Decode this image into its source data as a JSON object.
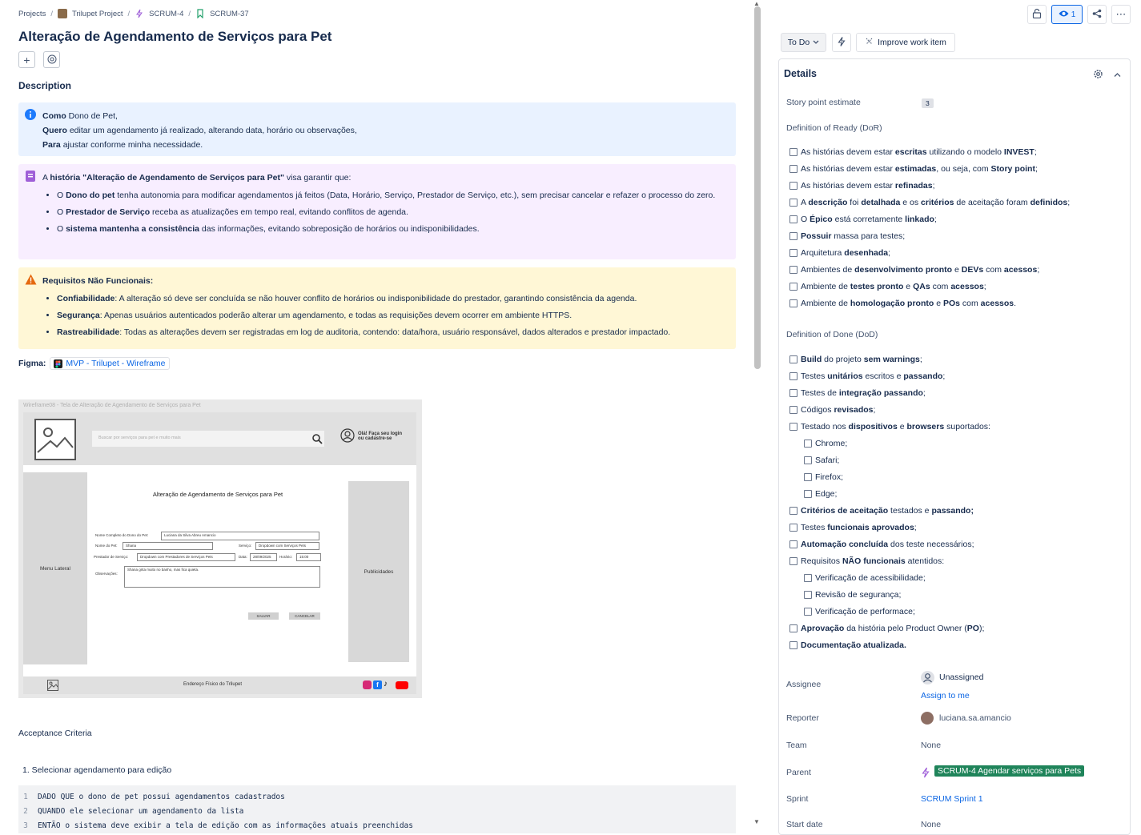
{
  "breadcrumb": {
    "projects": "Projects",
    "project": "Trilupet Project",
    "epic": "SCRUM-4",
    "issue": "SCRUM-37"
  },
  "issue": {
    "title": "Alteração de Agendamento de Serviços para Pet"
  },
  "description": {
    "heading": "Description",
    "info": {
      "l1_b": "Como",
      "l1": " Dono de Pet,",
      "l2_b": "Quero",
      "l2": " editar um agendamento já realizado, alterando data, horário ou observações,",
      "l3_b": "Para",
      "l3": " ajustar conforme minha necessidade."
    },
    "note": {
      "intro_a": "A ",
      "intro_b": "história \"Alteração de Agendamento de Serviços para Pet\"",
      "intro_c": " visa garantir que:",
      "b1_a": "O ",
      "b1_b": "Dono do pet",
      "b1_c": " tenha autonomia para modificar agendamentos já feitos (Data, Horário, Serviço, Prestador de Serviço, etc.), sem precisar cancelar e refazer o processo do zero.",
      "b2_a": "O ",
      "b2_b": "Prestador de Serviço",
      "b2_c": " receba as atualizações em tempo real, evitando conflitos de agenda.",
      "b3_a": "O ",
      "b3_b": "sistema mantenha a consistência",
      "b3_c": " das informações, evitando sobreposição de horários ou indisponibilidades."
    },
    "warn": {
      "title": "Requisitos Não Funcionais:",
      "b1_b": "Confiabilidade",
      "b1_c": ": A alteração só deve ser concluída se não houver conflito de horários ou indisponibilidade do prestador, garantindo consistência da agenda.",
      "b2_b": "Segurança",
      "b2_c": ": Apenas usuários autenticados poderão alterar um agendamento, e todas as requisições devem ocorrer em ambiente HTTPS.",
      "b3_b": "Rastreabilidade",
      "b3_c": ": Todas as alterações devem ser registradas em log de auditoria, contendo: data/hora, usuário responsável, dados alterados e prestador impactado."
    },
    "figma_label": "Figma:",
    "figma_link": "MVP - Trilupet - Wireframe"
  },
  "wireframe": {
    "caption": "Wireframe08 - Tela de Alteração de Agendamento de Serviços para Pet",
    "search_placeholder": "Buscar por serviços para pet e muito mais",
    "login_l1": "Olá! Faça seu login",
    "login_l2": "ou cadastre-se",
    "menu": "Menu Lateral",
    "ads": "Publicidades",
    "form_title": "Alteração de Agendamento de Serviços para Pet",
    "lbl_owner": "Nome Completo do Dono do Pet:",
    "val_owner": "Luciana da Silva Abreu Amancio",
    "lbl_pet": "Nome do Pet:",
    "val_pet": "Shana",
    "lbl_service": "Serviço:",
    "val_service": "Dropdown com Serviços Pets",
    "lbl_provider": "Prestador de Serviço:",
    "val_provider": "Dropdown com Prestadores de Serviços Pets",
    "lbl_date": "Data:",
    "val_date": "28/09/2025",
    "lbl_time": "Horário:",
    "val_time": "15:00",
    "lbl_obs": "Observações:",
    "val_obs": "Shana grita muito no banho, mas fica quieta.",
    "save": "SALVAR",
    "cancel": "CANCELAR",
    "address": "Endereço Físico do Trilupet"
  },
  "acceptance": {
    "heading": "Acceptance Criteria",
    "item1": "1. Selecionar agendamento para edição",
    "code": [
      {
        "n": "1",
        "t": "DADO QUE o dono de pet possui agendamentos cadastrados"
      },
      {
        "n": "2",
        "t": "QUANDO ele selecionar um agendamento da lista"
      },
      {
        "n": "3",
        "t": "ENTÃO o sistema deve exibir a tela de edição com as informações atuais preenchidas"
      }
    ]
  },
  "toolbar": {
    "watch_count": "1",
    "status": "To Do",
    "improve": "Improve work item"
  },
  "details": {
    "title": "Details",
    "story_points_label": "Story point estimate",
    "story_points": "3",
    "dor_label": "Definition of Ready (DoR)",
    "dod_label": "Definition of Done (DoD)",
    "assignee_label": "Assignee",
    "assignee": "Unassigned",
    "assign_to_me": "Assign to me",
    "reporter_label": "Reporter",
    "reporter": "luciana.sa.amancio",
    "team_label": "Team",
    "team": "None",
    "parent_label": "Parent",
    "parent": "SCRUM-4 Agendar serviços para Pets",
    "sprint_label": "Sprint",
    "sprint": "SCRUM Sprint 1",
    "start_label": "Start date",
    "start": "None"
  },
  "dor": [
    {
      "p": [
        [
          "As histórias devem estar ",
          0
        ],
        [
          "escritas",
          1
        ],
        [
          " utilizando o modelo ",
          0
        ],
        [
          "INVEST",
          1
        ],
        [
          ";",
          0
        ]
      ]
    },
    {
      "p": [
        [
          "As histórias devem estar ",
          0
        ],
        [
          "estimadas",
          1
        ],
        [
          ", ou seja, com ",
          0
        ],
        [
          "Story point",
          1
        ],
        [
          ";",
          0
        ]
      ]
    },
    {
      "p": [
        [
          "As histórias devem estar ",
          0
        ],
        [
          "refinadas",
          1
        ],
        [
          ";",
          0
        ]
      ]
    },
    {
      "p": [
        [
          "A ",
          0
        ],
        [
          "descrição",
          1
        ],
        [
          " foi ",
          0
        ],
        [
          "detalhada",
          1
        ],
        [
          " e os ",
          0
        ],
        [
          "critérios",
          1
        ],
        [
          " de aceitação foram ",
          0
        ],
        [
          "definidos",
          1
        ],
        [
          ";",
          0
        ]
      ]
    },
    {
      "p": [
        [
          "O ",
          0
        ],
        [
          "Épico",
          1
        ],
        [
          " está corretamente ",
          0
        ],
        [
          "linkado",
          1
        ],
        [
          ";",
          0
        ]
      ]
    },
    {
      "p": [
        [
          "Possuir",
          1
        ],
        [
          " massa para testes;",
          0
        ]
      ]
    },
    {
      "p": [
        [
          "Arquitetura ",
          0
        ],
        [
          "desenhada",
          1
        ],
        [
          ";",
          0
        ]
      ]
    },
    {
      "p": [
        [
          "Ambientes de ",
          0
        ],
        [
          "desenvolvimento pronto",
          1
        ],
        [
          " e ",
          0
        ],
        [
          "DEVs",
          1
        ],
        [
          " com ",
          0
        ],
        [
          "acessos",
          1
        ],
        [
          ";",
          0
        ]
      ]
    },
    {
      "p": [
        [
          "Ambiente de ",
          0
        ],
        [
          "testes pronto",
          1
        ],
        [
          " e ",
          0
        ],
        [
          "QAs",
          1
        ],
        [
          " com ",
          0
        ],
        [
          "acessos",
          1
        ],
        [
          ";",
          0
        ]
      ]
    },
    {
      "p": [
        [
          "Ambiente de ",
          0
        ],
        [
          "homologação pronto",
          1
        ],
        [
          " e ",
          0
        ],
        [
          "POs",
          1
        ],
        [
          " com ",
          0
        ],
        [
          "acessos",
          1
        ],
        [
          ".",
          0
        ]
      ]
    }
  ],
  "dod": [
    {
      "i": 0,
      "p": [
        [
          "Build",
          1
        ],
        [
          " do projeto ",
          0
        ],
        [
          "sem warnings",
          1
        ],
        [
          ";",
          0
        ]
      ]
    },
    {
      "i": 0,
      "p": [
        [
          "Testes ",
          0
        ],
        [
          "unitários",
          1
        ],
        [
          " escritos e ",
          0
        ],
        [
          "passando",
          1
        ],
        [
          ";",
          0
        ]
      ]
    },
    {
      "i": 0,
      "p": [
        [
          "Testes de ",
          0
        ],
        [
          "integração passando",
          1
        ],
        [
          ";",
          0
        ]
      ]
    },
    {
      "i": 0,
      "p": [
        [
          "Códigos ",
          0
        ],
        [
          "revisados",
          1
        ],
        [
          ";",
          0
        ]
      ]
    },
    {
      "i": 0,
      "p": [
        [
          "Testado nos ",
          0
        ],
        [
          "dispositivos",
          1
        ],
        [
          " e ",
          0
        ],
        [
          "browsers",
          1
        ],
        [
          " suportados:",
          0
        ]
      ]
    },
    {
      "i": 1,
      "p": [
        [
          "Chrome;",
          0
        ]
      ]
    },
    {
      "i": 1,
      "p": [
        [
          "Safari;",
          0
        ]
      ]
    },
    {
      "i": 1,
      "p": [
        [
          "Firefox;",
          0
        ]
      ]
    },
    {
      "i": 1,
      "p": [
        [
          "Edge;",
          0
        ]
      ]
    },
    {
      "i": 0,
      "p": [
        [
          "Critérios de aceitação",
          1
        ],
        [
          " testados e ",
          0
        ],
        [
          "passando;",
          1
        ]
      ]
    },
    {
      "i": 0,
      "p": [
        [
          "Testes ",
          0
        ],
        [
          "funcionais aprovados",
          1
        ],
        [
          ";",
          0
        ]
      ]
    },
    {
      "i": 0,
      "p": [
        [
          "Automação concluída",
          1
        ],
        [
          " dos teste necessários;",
          0
        ]
      ]
    },
    {
      "i": 0,
      "p": [
        [
          "Requisitos ",
          0
        ],
        [
          "NÃO funcionais",
          1
        ],
        [
          " atentidos:",
          0
        ]
      ]
    },
    {
      "i": 1,
      "p": [
        [
          "Verificação de acessibilidade;",
          0
        ]
      ]
    },
    {
      "i": 1,
      "p": [
        [
          "Revisão de segurança;",
          0
        ]
      ]
    },
    {
      "i": 1,
      "p": [
        [
          "Verificação de performace;",
          0
        ]
      ]
    },
    {
      "i": 0,
      "p": [
        [
          "Aprovação",
          1
        ],
        [
          " da história pelo Product Owner (",
          0
        ],
        [
          "PO",
          1
        ],
        [
          ");",
          0
        ]
      ]
    },
    {
      "i": 0,
      "p": [
        [
          "Documentação atualizada.",
          1
        ]
      ]
    }
  ],
  "colors": {
    "info_bg": "#e9f2ff",
    "note_bg": "#f8eeff",
    "warn_bg": "#fff7d6",
    "link": "#0c66e4",
    "parent_tag": "#1f845a"
  }
}
